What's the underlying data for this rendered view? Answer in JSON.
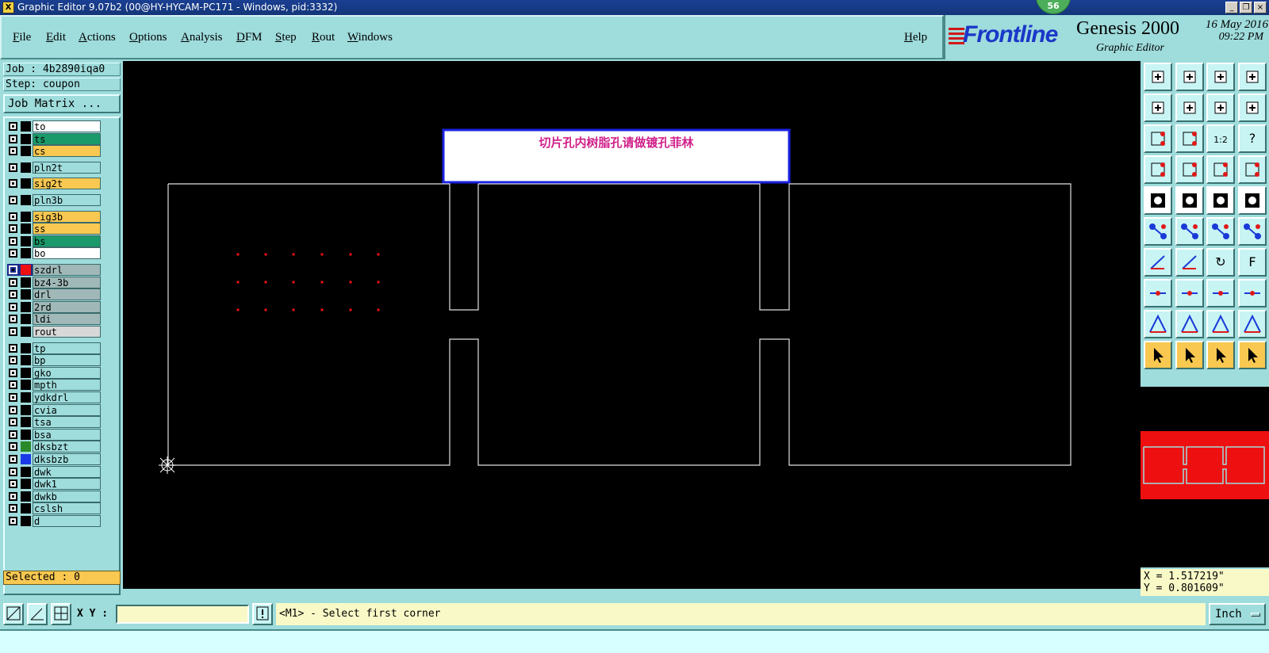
{
  "window": {
    "title": "Graphic Editor 9.07b2 (00@HY-HYCAM-PC171 - Windows, pid:3332)",
    "badge": "56"
  },
  "menu": {
    "items": [
      "File",
      "Edit",
      "Actions",
      "Options",
      "Analysis",
      "DFM",
      "Step",
      "Rout",
      "Windows"
    ],
    "help": "Help"
  },
  "brand": {
    "logo": "Frontline",
    "product": "Genesis 2000",
    "subtitle": "Graphic Editor",
    "date": "16 May 2016",
    "time": "09:22 PM"
  },
  "job": {
    "job_line": "Job : 4b2890iqa0",
    "step_line": "Step: coupon",
    "matrix_button": "Job Matrix ..."
  },
  "layers": [
    {
      "name": "to",
      "color": "#ffffff",
      "swatch": "#000000"
    },
    {
      "name": "ts",
      "color": "#1a9a6a",
      "swatch": "#000000"
    },
    {
      "name": "cs",
      "color": "#f8c850",
      "swatch": "#000000"
    },
    {
      "name": "pln2t",
      "color": "#9fdcdc",
      "swatch": "#000000"
    },
    {
      "name": "sig2t",
      "color": "#f8c850",
      "swatch": "#000000"
    },
    {
      "name": "pln3b",
      "color": "#9fdcdc",
      "swatch": "#000000"
    },
    {
      "name": "sig3b",
      "color": "#f8c850",
      "swatch": "#000000"
    },
    {
      "name": "ss",
      "color": "#f8c850",
      "swatch": "#000000"
    },
    {
      "name": "bs",
      "color": "#1a9a6a",
      "swatch": "#000000"
    },
    {
      "name": "bo",
      "color": "#ffffff",
      "swatch": "#000000"
    },
    {
      "name": "szdrl",
      "color": "#a0b8b8",
      "swatch": "#ee1010"
    },
    {
      "name": "bz4-3b",
      "color": "#a0b8b8",
      "swatch": "#000000"
    },
    {
      "name": "drl",
      "color": "#a0b8b8",
      "swatch": "#000000"
    },
    {
      "name": "2rd",
      "color": "#a0b8b8",
      "swatch": "#000000"
    },
    {
      "name": "ldi",
      "color": "#a0b8b8",
      "swatch": "#000000"
    },
    {
      "name": "rout",
      "color": "#d8d8d8",
      "swatch": "#000000"
    },
    {
      "name": "tp",
      "color": "#9fdcdc",
      "swatch": "#000000"
    },
    {
      "name": "bp",
      "color": "#9fdcdc",
      "swatch": "#000000"
    },
    {
      "name": "gko",
      "color": "#9fdcdc",
      "swatch": "#000000"
    },
    {
      "name": "mpth",
      "color": "#9fdcdc",
      "swatch": "#000000"
    },
    {
      "name": "ydkdrl",
      "color": "#9fdcdc",
      "swatch": "#000000"
    },
    {
      "name": "cvia",
      "color": "#9fdcdc",
      "swatch": "#000000"
    },
    {
      "name": "tsa",
      "color": "#9fdcdc",
      "swatch": "#000000"
    },
    {
      "name": "bsa",
      "color": "#9fdcdc",
      "swatch": "#000000"
    },
    {
      "name": "dksbzt",
      "color": "#9fdcdc",
      "swatch": "#2a8a2a"
    },
    {
      "name": "dksbzb",
      "color": "#9fdcdc",
      "swatch": "#1a3ae8"
    },
    {
      "name": "dwk",
      "color": "#9fdcdc",
      "swatch": "#000000"
    },
    {
      "name": "dwk1",
      "color": "#9fdcdc",
      "swatch": "#000000"
    },
    {
      "name": "dwkb",
      "color": "#9fdcdc",
      "swatch": "#000000"
    },
    {
      "name": "cslsh",
      "color": "#9fdcdc",
      "swatch": "#000000"
    },
    {
      "name": "d",
      "color": "#9fdcdc",
      "swatch": "#000000"
    }
  ],
  "selected": "Selected : 0",
  "canvas": {
    "annotation": "切片孔内树脂孔请做镀孔菲林"
  },
  "coords": {
    "x": "X = 1.517219\"",
    "y": "Y = 0.801609\""
  },
  "bottom": {
    "xy_label": "X Y :",
    "xy_value": "",
    "prompt": "<M1> - Select first corner",
    "unit": "Inch"
  },
  "toolbar": {
    "icons": [
      "zoom-home-icon",
      "zoom-extent-icon",
      "home-icon",
      "zoom-window-icon",
      "pan-left-icon",
      "pan-right-icon",
      "undo-view-icon",
      "redraw-icon",
      "fit-icon",
      "zoom-out-icon",
      "scale-1-2-icon",
      "help-icon",
      "measure-icon",
      "grid-icon",
      "layer-red-icon",
      "layer-red2-icon",
      "select-pad-icon",
      "select-line-icon",
      "ruler-icon",
      "feature-dot-icon",
      "connect-nodes-icon",
      "delete-node-icon",
      "move-point-icon",
      "move-point2-icon",
      "draw-line-icon",
      "draw-line2-icon",
      "rotate-icon",
      "mirror-icon",
      "snap-icon",
      "trim-icon",
      "dimension-icon",
      "group-icon",
      "arc-icon",
      "arc2-icon",
      "arc3-icon",
      "arc4-icon",
      "pointer-icon",
      "pointer-box-icon",
      "pointer-circle-icon",
      "pointer-path-icon"
    ]
  },
  "colors": {
    "panel": "#9fdcdc",
    "highlight_orange": "#f8c850",
    "drill_red": "#ee1010",
    "annotation_magenta": "#d0208a"
  }
}
